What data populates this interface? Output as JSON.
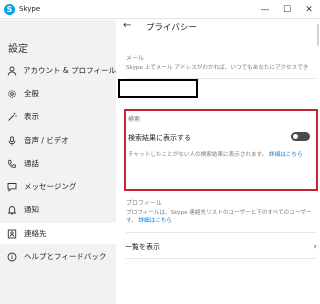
{
  "window": {
    "title": "Skype",
    "controls": {
      "minimize": "—",
      "maximize": "☐",
      "close": "✕"
    }
  },
  "sidebar": {
    "heading": "設定",
    "items": [
      {
        "label": "アカウント & プロフィール",
        "icon": "person-icon"
      },
      {
        "label": "全般",
        "icon": "gear-icon"
      },
      {
        "label": "表示",
        "icon": "wand-icon"
      },
      {
        "label": "音声 / ビデオ",
        "icon": "microphone-icon"
      },
      {
        "label": "通話",
        "icon": "phone-icon"
      },
      {
        "label": "メッセージング",
        "icon": "chat-icon"
      },
      {
        "label": "通知",
        "icon": "bell-icon"
      },
      {
        "label": "連絡先",
        "icon": "contacts-icon",
        "active": true
      },
      {
        "label": "ヘルプとフィードバック",
        "icon": "info-icon"
      }
    ]
  },
  "main": {
    "back": "←",
    "title": "プライバシー",
    "email": {
      "label": "メール",
      "desc": "Skype 上でメール アドレスがわかれば、いつでもあなたにアクセスでき"
    },
    "search": {
      "label": "検索",
      "setting_label": "検索結果に表示する",
      "toggle_on": false,
      "desc": "チャットしたことがない人の検索結果に表示されます。",
      "link": "詳細はこちら"
    },
    "profile": {
      "label": "プロフィール",
      "desc": "プロフィールは、Skype 連絡先リストのユーザーと下のすべてのユーザー",
      "desc2": "す。",
      "link": "詳細はこちら"
    },
    "show_list": {
      "label": "一覧を表示",
      "chevron": "›"
    }
  },
  "colors": {
    "highlight": "#c1272d",
    "link": "#0078d4",
    "sidebar_bg": "#f2f2f2",
    "skype": "#00a2ed"
  }
}
